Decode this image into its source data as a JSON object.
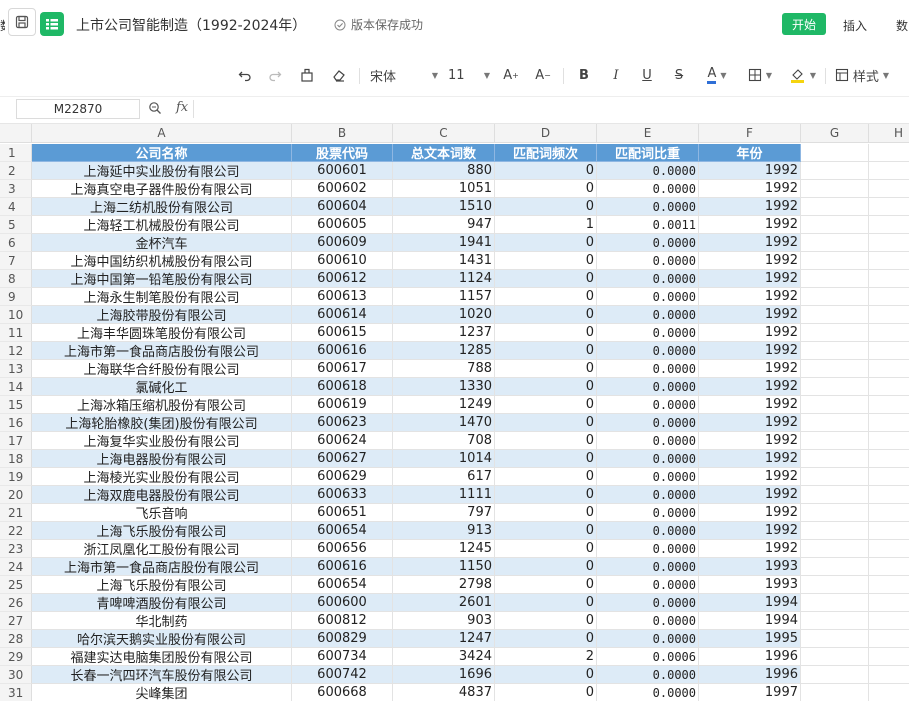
{
  "app": {
    "title": "上市公司智能制造（1992-2024年）",
    "save_status": "版本保存成功",
    "left_cut": "数",
    "menu": {
      "start": "开始",
      "insert": "插入",
      "data": "数"
    }
  },
  "toolbar": {
    "font_name": "宋体",
    "font_size": "11",
    "style_label": "样式"
  },
  "formula_bar": {
    "cell_ref": "M22870",
    "fx": "fx",
    "value": ""
  },
  "colors": {
    "accent": "#1fb866",
    "header_fill": "#5b9bd5",
    "band_fill": "#ddebf7"
  },
  "sheet": {
    "columns": [
      "A",
      "B",
      "C",
      "D",
      "E",
      "F",
      "G",
      "H"
    ],
    "headers": [
      "公司名称",
      "股票代码",
      "总文本词数",
      "匹配词频次",
      "匹配词比重",
      "年份"
    ],
    "rows": [
      [
        "上海延中实业股份有限公司",
        "600601",
        "880",
        "0",
        "0.0000",
        "1992"
      ],
      [
        "上海真空电子器件股份有限公司",
        "600602",
        "1051",
        "0",
        "0.0000",
        "1992"
      ],
      [
        "上海二纺机股份有限公司",
        "600604",
        "1510",
        "0",
        "0.0000",
        "1992"
      ],
      [
        "上海轻工机械股份有限公司",
        "600605",
        "947",
        "1",
        "0.0011",
        "1992"
      ],
      [
        "金杯汽车",
        "600609",
        "1941",
        "0",
        "0.0000",
        "1992"
      ],
      [
        "上海中国纺织机械股份有限公司",
        "600610",
        "1431",
        "0",
        "0.0000",
        "1992"
      ],
      [
        "上海中国第一铅笔股份有限公司",
        "600612",
        "1124",
        "0",
        "0.0000",
        "1992"
      ],
      [
        "上海永生制笔股份有限公司",
        "600613",
        "1157",
        "0",
        "0.0000",
        "1992"
      ],
      [
        "上海胶带股份有限公司",
        "600614",
        "1020",
        "0",
        "0.0000",
        "1992"
      ],
      [
        "上海丰华圆珠笔股份有限公司",
        "600615",
        "1237",
        "0",
        "0.0000",
        "1992"
      ],
      [
        "上海市第一食品商店股份有限公司",
        "600616",
        "1285",
        "0",
        "0.0000",
        "1992"
      ],
      [
        "上海联华合纤股份有限公司",
        "600617",
        "788",
        "0",
        "0.0000",
        "1992"
      ],
      [
        "氯碱化工",
        "600618",
        "1330",
        "0",
        "0.0000",
        "1992"
      ],
      [
        "上海冰箱压缩机股份有限公司",
        "600619",
        "1249",
        "0",
        "0.0000",
        "1992"
      ],
      [
        "上海轮胎橡胶(集团)股份有限公司",
        "600623",
        "1470",
        "0",
        "0.0000",
        "1992"
      ],
      [
        "上海复华实业股份有限公司",
        "600624",
        "708",
        "0",
        "0.0000",
        "1992"
      ],
      [
        "上海电器股份有限公司",
        "600627",
        "1014",
        "0",
        "0.0000",
        "1992"
      ],
      [
        "上海棱光实业股份有限公司",
        "600629",
        "617",
        "0",
        "0.0000",
        "1992"
      ],
      [
        "上海双鹿电器股份有限公司",
        "600633",
        "1111",
        "0",
        "0.0000",
        "1992"
      ],
      [
        "飞乐音响",
        "600651",
        "797",
        "0",
        "0.0000",
        "1992"
      ],
      [
        "上海飞乐股份有限公司",
        "600654",
        "913",
        "0",
        "0.0000",
        "1992"
      ],
      [
        "浙江凤凰化工股份有限公司",
        "600656",
        "1245",
        "0",
        "0.0000",
        "1992"
      ],
      [
        "上海市第一食品商店股份有限公司",
        "600616",
        "1150",
        "0",
        "0.0000",
        "1993"
      ],
      [
        "上海飞乐股份有限公司",
        "600654",
        "2798",
        "0",
        "0.0000",
        "1993"
      ],
      [
        "青啤啤酒股份有限公司",
        "600600",
        "2601",
        "0",
        "0.0000",
        "1994"
      ],
      [
        "华北制药",
        "600812",
        "903",
        "0",
        "0.0000",
        "1994"
      ],
      [
        "哈尔滨天鹅实业股份有限公司",
        "600829",
        "1247",
        "0",
        "0.0000",
        "1995"
      ],
      [
        "福建实达电脑集团股份有限公司",
        "600734",
        "3424",
        "2",
        "0.0006",
        "1996"
      ],
      [
        "长春一汽四环汽车股份有限公司",
        "600742",
        "1696",
        "0",
        "0.0000",
        "1996"
      ],
      [
        "尖峰集团",
        "600668",
        "4837",
        "0",
        "0.0000",
        "1997"
      ]
    ]
  }
}
